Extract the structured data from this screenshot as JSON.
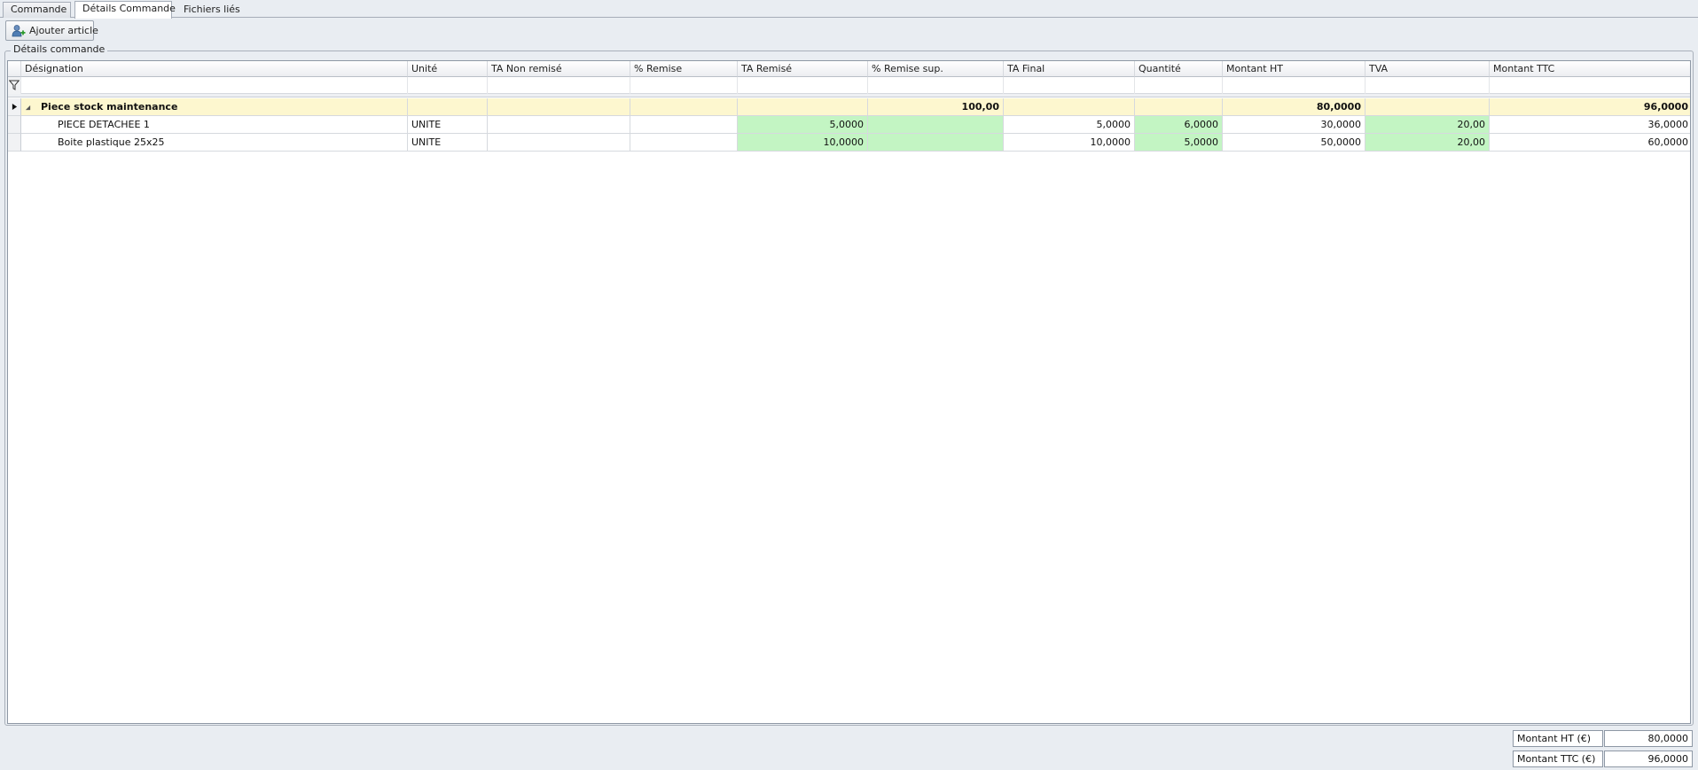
{
  "tabs": [
    {
      "label": "Commande",
      "active": false
    },
    {
      "label": "Détails Commande",
      "active": true
    },
    {
      "label": "Fichiers liés",
      "active": false
    }
  ],
  "toolbar": {
    "add_article_label": "Ajouter article"
  },
  "group": {
    "title": "Détails commande"
  },
  "table": {
    "columns": [
      "Désignation",
      "Unité",
      "TA Non remisé",
      "% Remise",
      "TA Remisé",
      "% Remise sup.",
      "TA Final",
      "Quantité",
      "Montant HT",
      "TVA",
      "Montant TTC"
    ],
    "group_row": {
      "designation": "Piece stock maintenance",
      "remise_sup": "100,00",
      "montant_ht": "80,0000",
      "montant_ttc": "96,0000"
    },
    "rows": [
      {
        "designation": "PIECE DETACHEE 1",
        "unite": "UNITE",
        "ta_non_remise": "",
        "remise": "",
        "ta_remise": "5,0000",
        "remise_sup": "",
        "ta_final": "5,0000",
        "quantite": "6,0000",
        "montant_ht": "30,0000",
        "tva": "20,00",
        "montant_ttc": "36,0000"
      },
      {
        "designation": "Boite plastique 25x25",
        "unite": "UNITE",
        "ta_non_remise": "",
        "remise": "",
        "ta_remise": "10,0000",
        "remise_sup": "",
        "ta_final": "10,0000",
        "quantite": "5,0000",
        "montant_ht": "50,0000",
        "tva": "20,00",
        "montant_ttc": "60,0000"
      }
    ]
  },
  "totals": {
    "ht_label": "Montant HT (€)",
    "ht_value": "80,0000",
    "ttc_label": "Montant TTC (€)",
    "ttc_value": "96,0000"
  },
  "colors": {
    "group_row": "#fdf7cf",
    "editable_cell": "#c3f5c3"
  }
}
